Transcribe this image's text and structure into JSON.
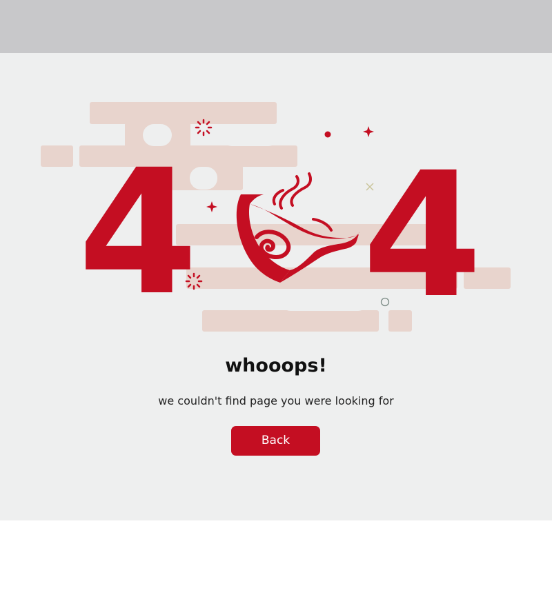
{
  "error_page": {
    "code_left_digit": "4",
    "code_right_digit": "4",
    "title": "whooops!",
    "message": "we couldn't find page you were looking for",
    "back_button_label": "Back"
  },
  "colors": {
    "top_bar": "#c8c8ca",
    "background": "#eeefef",
    "accent_red": "#c40e22",
    "cloud": "#e8d4cd",
    "footer": "#ffffff"
  },
  "icons": {
    "center_graphic": "hot-bowl-icon",
    "decorations": [
      "sparkle-icon",
      "star-icon",
      "dot-icon",
      "cross-icon",
      "ring-icon"
    ]
  }
}
